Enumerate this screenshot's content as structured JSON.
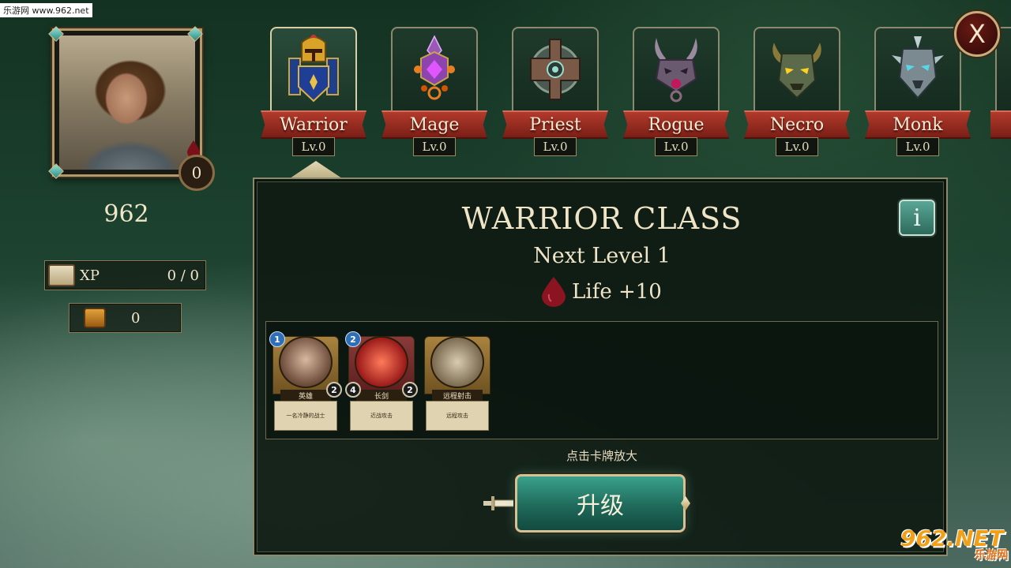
{
  "watermark_top": "乐游网 www.962.net",
  "watermark_bottom": {
    "logo": "962.NET",
    "sub": "乐游网"
  },
  "player": {
    "soul_count": "0",
    "gold": "962",
    "xp_label": "XP",
    "xp_value": "0 / 0",
    "chest_count": "0"
  },
  "classes": [
    {
      "name": "Warrior",
      "level": "Lv.0",
      "active": true,
      "icon": "helmet-icon"
    },
    {
      "name": "Mage",
      "level": "Lv.0",
      "active": false,
      "icon": "crystal-icon"
    },
    {
      "name": "Priest",
      "level": "Lv.0",
      "active": false,
      "icon": "holy-cross-icon"
    },
    {
      "name": "Rogue",
      "level": "Lv.0",
      "active": false,
      "icon": "horned-mask-icon"
    },
    {
      "name": "Necro",
      "level": "Lv.0",
      "active": false,
      "icon": "demon-skull-icon"
    },
    {
      "name": "Monk",
      "level": "Lv.0",
      "active": false,
      "icon": "spiked-mask-icon"
    }
  ],
  "close_label": "X",
  "panel": {
    "title": "WARRIOR CLASS",
    "next_level": "Next Level 1",
    "reward": "Life +10",
    "info_label": "i",
    "hint": "点击卡牌放大",
    "upgrade_label": "升级"
  },
  "cards": [
    {
      "name": "英雄",
      "text": "一名冷静的战士",
      "badge_top": "1",
      "badge_right": "2",
      "badge_left": ""
    },
    {
      "name": "长剑",
      "text": "近战攻击",
      "badge_top": "2",
      "badge_right": "2",
      "badge_left": "4"
    },
    {
      "name": "远程射击",
      "text": "远程攻击",
      "badge_top": "",
      "badge_right": "",
      "badge_left": ""
    }
  ],
  "colors": {
    "banner_red": "#9a2c20",
    "accent_teal": "#2d7f6c",
    "frame_gold": "#c7ad7a"
  }
}
